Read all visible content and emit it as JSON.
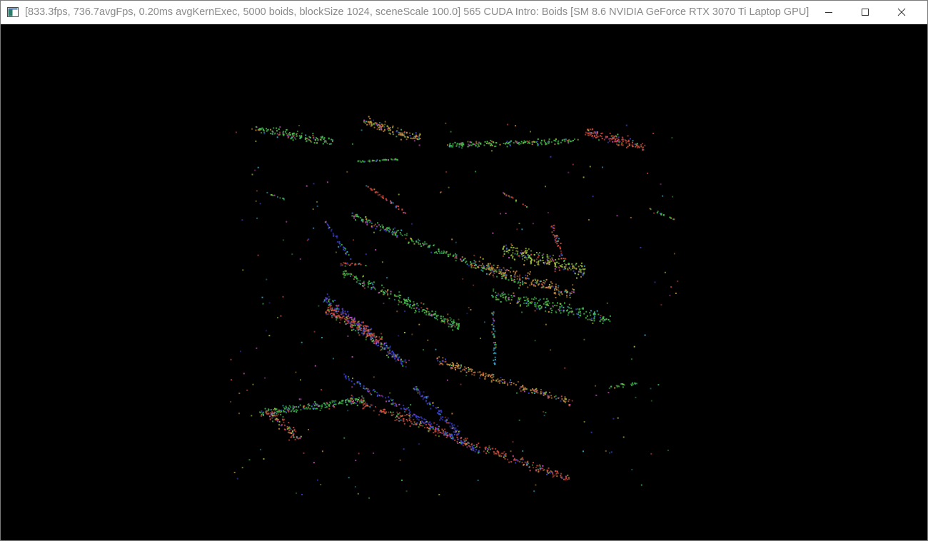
{
  "window": {
    "title": "[833.3fps, 736.7avgFps, 0.20ms avgKernExec, 5000 boids, blockSize 1024, sceneScale 100.0] 565 CUDA Intro: Boids [SM 8.6 NVIDIA GeForce RTX 3070 Ti Laptop GPU]",
    "app_icon": "console-window-icon",
    "controls": {
      "minimize_icon": "minimize-icon",
      "maximize_icon": "maximize-icon",
      "close_icon": "close-icon"
    }
  },
  "simulation": {
    "boid_count": 5000,
    "background_color": "#000000",
    "particle_colors": [
      "#3fbf4a",
      "#d0473a",
      "#3b3fd6",
      "#35a8c9",
      "#c94fbf",
      "#9fc23a",
      "#c98a3a"
    ]
  }
}
